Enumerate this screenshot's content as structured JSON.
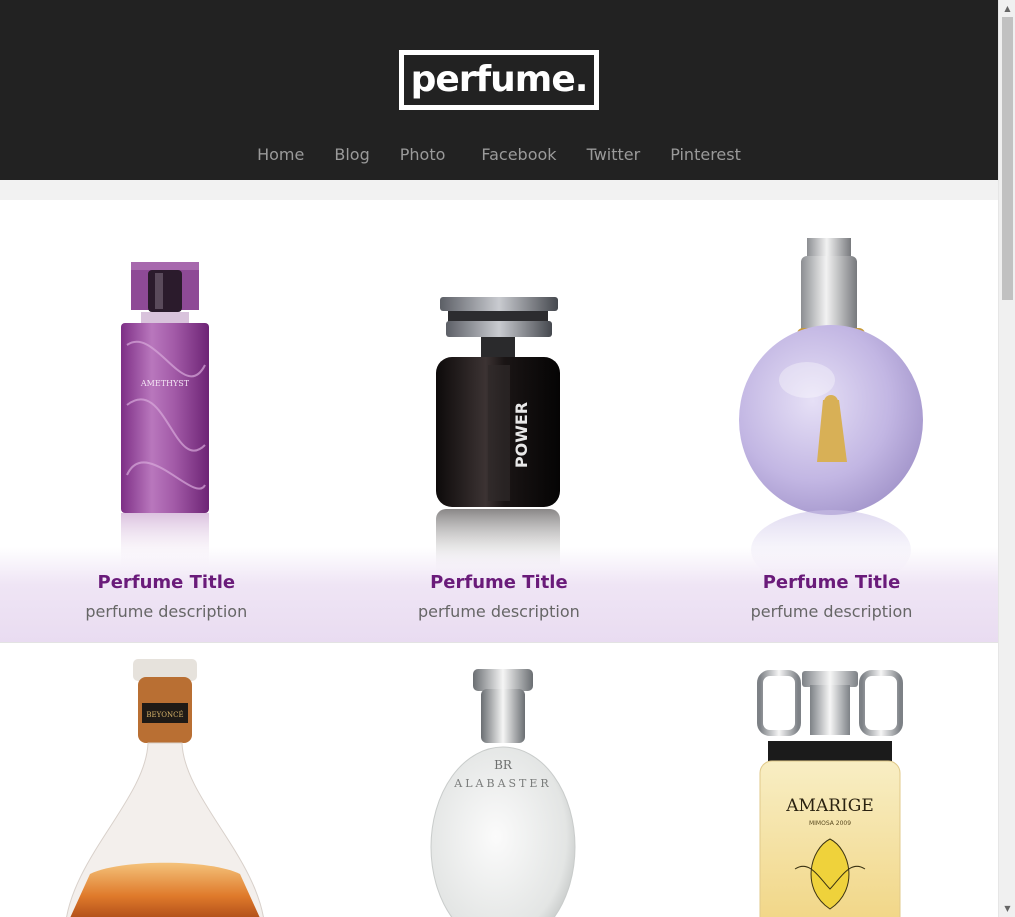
{
  "header": {
    "logo_text": "perfume.",
    "nav": [
      "Home",
      "Blog",
      "Photo",
      "Facebook",
      "Twitter",
      "Pinterest"
    ]
  },
  "products": [
    {
      "title": "Perfume Title",
      "description": "perfume description",
      "bottle_label": "AMETHYST",
      "bottle_color": "#9b4aa0"
    },
    {
      "title": "Perfume Title",
      "description": "perfume description",
      "bottle_label": "POWER",
      "bottle_color": "#1e1a1a"
    },
    {
      "title": "Perfume Title",
      "description": "perfume description",
      "bottle_label": "",
      "bottle_color": "#c9bfe6"
    },
    {
      "title": "",
      "description": "",
      "bottle_label": "BEYONCÉ",
      "bottle_color": "#d9772b"
    },
    {
      "title": "",
      "description": "",
      "bottle_label": "ALABASTER",
      "bottle_color": "#e9eaea"
    },
    {
      "title": "",
      "description": "",
      "bottle_label": "AMARIGE",
      "bottle_sublabel": "MIMOSA 2009",
      "bottle_color": "#f1dd99"
    }
  ],
  "colors": {
    "header_bg": "#222222",
    "title_color": "#6a1b7a",
    "nav_color": "#9a9a9a",
    "card_shade": "#efe5f5"
  },
  "icons": {
    "scroll_up": "▲",
    "scroll_down": "▼"
  }
}
